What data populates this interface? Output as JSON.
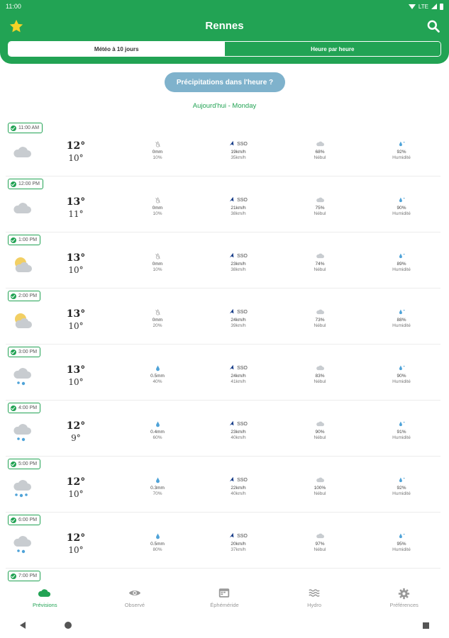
{
  "status_bar": {
    "time": "11:00",
    "network": "LTE"
  },
  "header": {
    "city": "Rennes"
  },
  "tabs": [
    {
      "label": "Météo à 10 jours",
      "active": true
    },
    {
      "label": "Heure par heure",
      "active": false
    }
  ],
  "precip_button": "Précipitations dans l'heure ?",
  "day_label": "Aujourd'hui - Monday",
  "hours": [
    {
      "time": "11:00 AM",
      "icon": "cloud-icon",
      "tmax": "12°",
      "tmin": "10°",
      "precip": "0mm",
      "precip_prob": "10%",
      "precip_icon": "no-rain-icon",
      "wind_dir": "SSO",
      "wind": "19km/h",
      "gust": "35km/h",
      "cloud": "68%",
      "cloud_label": "Nébul",
      "humidity": "92%",
      "humidity_label": "Humidité"
    },
    {
      "time": "12:00 PM",
      "icon": "cloud-icon",
      "tmax": "13°",
      "tmin": "11°",
      "precip": "0mm",
      "precip_prob": "10%",
      "precip_icon": "no-rain-icon",
      "wind_dir": "SSO",
      "wind": "21km/h",
      "gust": "38km/h",
      "cloud": "75%",
      "cloud_label": "Nébul",
      "humidity": "90%",
      "humidity_label": "Humidité"
    },
    {
      "time": "1:00 PM",
      "icon": "sun-cloud-icon",
      "tmax": "13°",
      "tmin": "10°",
      "precip": "0mm",
      "precip_prob": "10%",
      "precip_icon": "no-rain-icon",
      "wind_dir": "SSO",
      "wind": "23km/h",
      "gust": "38km/h",
      "cloud": "74%",
      "cloud_label": "Nébul",
      "humidity": "89%",
      "humidity_label": "Humidité"
    },
    {
      "time": "2:00 PM",
      "icon": "sun-cloud-icon",
      "tmax": "13°",
      "tmin": "10°",
      "precip": "0mm",
      "precip_prob": "20%",
      "precip_icon": "no-rain-icon",
      "wind_dir": "SSO",
      "wind": "24km/h",
      "gust": "39km/h",
      "cloud": "73%",
      "cloud_label": "Nébul",
      "humidity": "88%",
      "humidity_label": "Humidité"
    },
    {
      "time": "3:00 PM",
      "icon": "rain-cloud-icon",
      "tmax": "13°",
      "tmin": "10°",
      "precip": "0.5mm",
      "precip_prob": "40%",
      "precip_icon": "rain-drop-icon",
      "wind_dir": "SSO",
      "wind": "24km/h",
      "gust": "41km/h",
      "cloud": "83%",
      "cloud_label": "Nébul",
      "humidity": "90%",
      "humidity_label": "Humidité"
    },
    {
      "time": "4:00 PM",
      "icon": "rain-cloud-icon",
      "tmax": "12°",
      "tmin": "9°",
      "precip": "0.4mm",
      "precip_prob": "60%",
      "precip_icon": "rain-drop-icon",
      "wind_dir": "SSO",
      "wind": "23km/h",
      "gust": "40km/h",
      "cloud": "90%",
      "cloud_label": "Nébul",
      "humidity": "91%",
      "humidity_label": "Humidité"
    },
    {
      "time": "5:00 PM",
      "icon": "heavy-rain-cloud-icon",
      "tmax": "12°",
      "tmin": "10°",
      "precip": "0.3mm",
      "precip_prob": "70%",
      "precip_icon": "rain-drop-icon",
      "wind_dir": "SSO",
      "wind": "22km/h",
      "gust": "40km/h",
      "cloud": "100%",
      "cloud_label": "Nébul",
      "humidity": "92%",
      "humidity_label": "Humidité"
    },
    {
      "time": "6:00 PM",
      "icon": "rain-cloud-icon",
      "tmax": "12°",
      "tmin": "10°",
      "precip": "0.5mm",
      "precip_prob": "80%",
      "precip_icon": "rain-drop-icon",
      "wind_dir": "SSO",
      "wind": "20km/h",
      "gust": "37km/h",
      "cloud": "97%",
      "cloud_label": "Nébul",
      "humidity": "95%",
      "humidity_label": "Humidité"
    }
  ],
  "next_hour": "7:00 PM",
  "bottom_nav": [
    {
      "label": "Prévisions",
      "icon": "cloud-nav-icon",
      "active": true
    },
    {
      "label": "Observé",
      "icon": "eye-icon",
      "active": false
    },
    {
      "label": "Éphéméride",
      "icon": "calendar-icon",
      "active": false
    },
    {
      "label": "Hydro",
      "icon": "waves-icon",
      "active": false
    },
    {
      "label": "Préférences",
      "icon": "gear-icon",
      "active": false
    }
  ],
  "colors": {
    "brand": "#22a354",
    "precip_button": "#7fb2cc",
    "wind_arrow": "#1a3f8a",
    "drop": "#4fa3d8"
  }
}
